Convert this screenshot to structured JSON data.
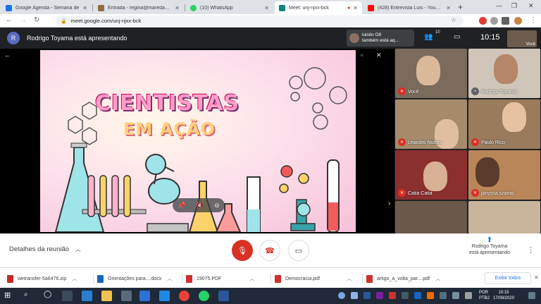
{
  "browser": {
    "tabs": [
      {
        "label": "Google Agenda - Semana de",
        "icon": "calendar-icon",
        "color": "#1a73e8"
      },
      {
        "label": "Entrada - regina@maredakido",
        "icon": "mail-icon",
        "color": "#8d6e3e"
      },
      {
        "label": "(10) WhatsApp",
        "icon": "whatsapp-icon",
        "color": "#25d366"
      },
      {
        "label": "Meet: unj-njxx-bck",
        "icon": "meet-icon",
        "color": "#00897b",
        "active": true
      },
      {
        "label": "(428) Entrevista Luís - YouTube",
        "icon": "youtube-icon",
        "color": "#ff0000"
      }
    ],
    "new_tab": "+",
    "url": "meet.google.com/unj-njxx-bck"
  },
  "meet": {
    "presenter_initial": "R",
    "presenter_text": "Rodrigo Toyama está apresentando",
    "also_presenting": "luisito O8\ntambém está aq...",
    "participant_count": "10",
    "clock": "10:15",
    "self_mini_label": "Você",
    "slide_title_line1": "CIENTISTAS",
    "slide_title_line2": "EM AÇÃO",
    "participants": [
      {
        "name": "Você"
      },
      {
        "name": "Rodrigo Toyama"
      },
      {
        "name": "Leandro Nunes"
      },
      {
        "name": "Paulo Rico"
      },
      {
        "name": "Catia Catia"
      },
      {
        "name": "janyssa szanto"
      },
      {
        "name": ""
      },
      {
        "name": ""
      }
    ],
    "details_label": "Detalhes da reunião",
    "presenting_label": "Rodrigo Toyama\nestá apresentando"
  },
  "downloads": {
    "items": [
      {
        "label": "wetransfer-5a6476.zip",
        "color": "#c62828"
      },
      {
        "label": "Orientações para....docx",
        "color": "#1565c0"
      },
      {
        "label": "19075.PDF",
        "color": "#d32f2f"
      },
      {
        "label": "Democracia.pdf",
        "color": "#d32f2f"
      },
      {
        "label": "artigo_a_volta_par....pdf",
        "color": "#d32f2f"
      }
    ],
    "show_all": "Exibir todos"
  },
  "taskbar": {
    "lang": "POR\nPTB2",
    "time": "10:15",
    "date": "17/09/2020"
  }
}
